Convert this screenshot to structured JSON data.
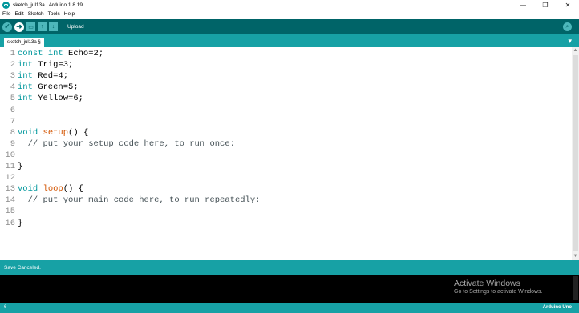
{
  "window": {
    "title": "sketch_jul13a | Arduino 1.8.19",
    "minimize": "—",
    "maximize": "❐",
    "close": "✕"
  },
  "menu": [
    "File",
    "Edit",
    "Sketch",
    "Tools",
    "Help"
  ],
  "toolbar": {
    "verify_icon": "check-icon",
    "upload_icon": "arrow-right-icon",
    "new_icon": "new-file-icon",
    "open_icon": "open-icon",
    "save_icon": "save-icon",
    "hover_label": "Upload",
    "serial_icon": "magnifier-icon"
  },
  "tabs": {
    "active": "sketch_jul13a §",
    "menu_icon": "tab-menu-icon"
  },
  "editor": {
    "lines": [
      {
        "no": "1",
        "tokens": [
          {
            "t": "const ",
            "c": "kw-type"
          },
          {
            "t": "int",
            "c": "kw-type"
          },
          {
            "t": " Echo=2;",
            "c": ""
          }
        ]
      },
      {
        "no": "2",
        "tokens": [
          {
            "t": "int",
            "c": "kw-type"
          },
          {
            "t": " Trig=3;",
            "c": ""
          }
        ]
      },
      {
        "no": "3",
        "tokens": [
          {
            "t": "int",
            "c": "kw-type"
          },
          {
            "t": " Red=4;",
            "c": ""
          }
        ]
      },
      {
        "no": "4",
        "tokens": [
          {
            "t": "int",
            "c": "kw-type"
          },
          {
            "t": " Green=5;",
            "c": ""
          }
        ]
      },
      {
        "no": "5",
        "tokens": [
          {
            "t": "int",
            "c": "kw-type"
          },
          {
            "t": " Yellow=6;",
            "c": ""
          }
        ]
      },
      {
        "no": "6",
        "tokens": []
      },
      {
        "no": "7",
        "tokens": []
      },
      {
        "no": "8",
        "tokens": [
          {
            "t": "void",
            "c": "kw-type"
          },
          {
            "t": " ",
            "c": ""
          },
          {
            "t": "setup",
            "c": "kw-fn"
          },
          {
            "t": "() {",
            "c": ""
          }
        ]
      },
      {
        "no": "9",
        "tokens": [
          {
            "t": "  // put your setup code here, to run once:",
            "c": "cmt"
          }
        ]
      },
      {
        "no": "10",
        "tokens": []
      },
      {
        "no": "11",
        "tokens": [
          {
            "t": "}",
            "c": ""
          }
        ]
      },
      {
        "no": "12",
        "tokens": []
      },
      {
        "no": "13",
        "tokens": [
          {
            "t": "void",
            "c": "kw-type"
          },
          {
            "t": " ",
            "c": ""
          },
          {
            "t": "loop",
            "c": "kw-fn"
          },
          {
            "t": "() {",
            "c": ""
          }
        ]
      },
      {
        "no": "14",
        "tokens": [
          {
            "t": "  // put your main code here, to run repeatedly:",
            "c": "cmt"
          }
        ]
      },
      {
        "no": "15",
        "tokens": []
      },
      {
        "no": "16",
        "tokens": [
          {
            "t": "}",
            "c": ""
          }
        ]
      }
    ],
    "cursor_line": 6
  },
  "status": {
    "message": "Save Canceled."
  },
  "console": {
    "watermark_title": "Activate Windows",
    "watermark_sub": "Go to Settings to activate Windows."
  },
  "bottom": {
    "line_indicator": "6",
    "board": "Arduino Uno"
  },
  "colors": {
    "toolbar_bg": "#006468",
    "accent": "#17a1a5",
    "keyword": "#00979c",
    "function": "#d35400"
  }
}
